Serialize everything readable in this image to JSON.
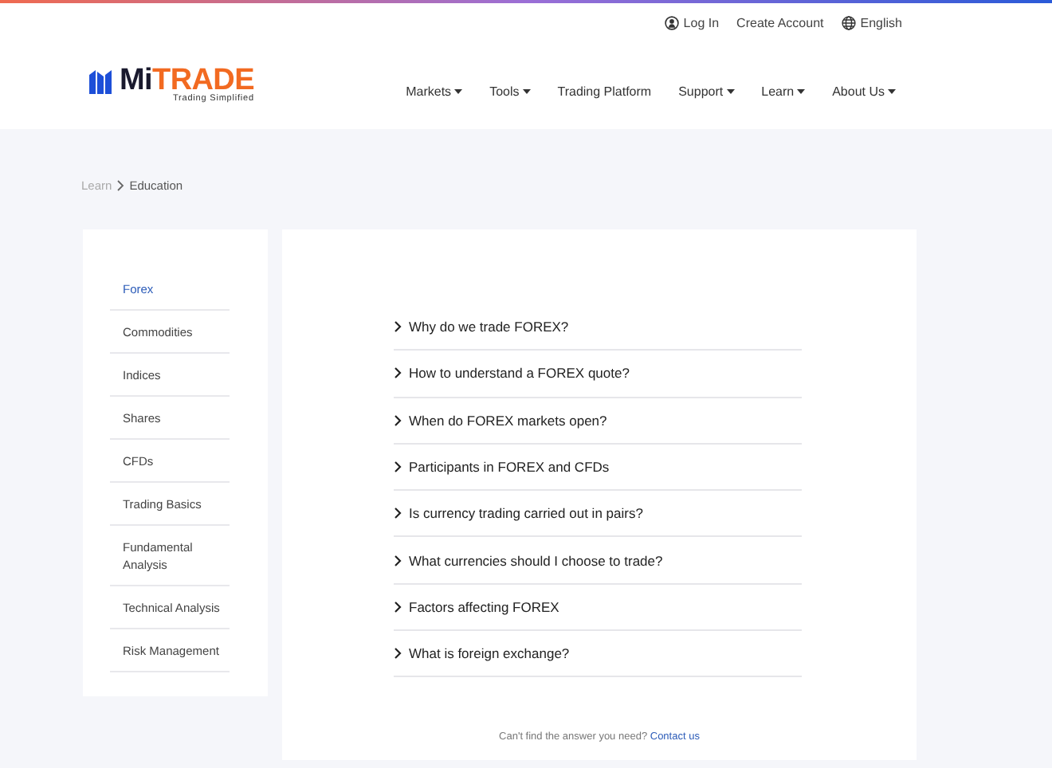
{
  "top_links": [
    {
      "label": "Log In"
    },
    {
      "label": "Create Account"
    },
    {
      "label": "English"
    }
  ],
  "logo": {
    "first": "Mi",
    "second": "TRADE",
    "tagline": "Trading Simplified"
  },
  "nav": [
    {
      "label": "Markets",
      "has_menu": true
    },
    {
      "label": "Tools",
      "has_menu": true
    },
    {
      "label": "Trading Platform",
      "has_menu": false
    },
    {
      "label": "Support",
      "has_menu": true
    },
    {
      "label": "Learn",
      "has_menu": true
    },
    {
      "label": "About Us",
      "has_menu": true
    }
  ],
  "breadcrumb": [
    "Learn",
    "Education"
  ],
  "sidebar": [
    {
      "label": "Forex",
      "selected": true
    },
    {
      "label": "Commodities",
      "selected": false
    },
    {
      "label": "Indices",
      "selected": false
    },
    {
      "label": "Shares",
      "selected": false
    },
    {
      "label": "CFDs",
      "selected": false
    },
    {
      "label": "Trading Basics",
      "selected": false
    },
    {
      "label": "Fundamental Analysis",
      "selected": false
    },
    {
      "label": "Technical Analysis",
      "selected": false
    },
    {
      "label": "Risk Management",
      "selected": false
    }
  ],
  "questions": [
    "Why do we trade FOREX?",
    "How to understand a FOREX quote?",
    "When do FOREX markets open?",
    "Participants in FOREX and CFDs",
    "Is currency trading carried out in pairs?",
    "What currencies should I choose to trade?",
    "Factors affecting FOREX",
    "What is foreign exchange?"
  ],
  "footer": {
    "text": "Can't find the answer you need?",
    "link": "Contact us"
  }
}
